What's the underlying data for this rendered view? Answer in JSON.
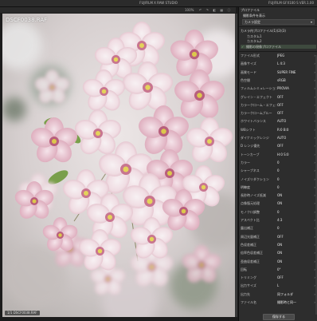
{
  "window": {
    "title": "FUJIFILM X RAW STUDIO",
    "right_title": "FUJIFILM GFX100 S   VER.1.00"
  },
  "toolbar": {
    "zoom": "100%",
    "icons": [
      "undo-icon",
      "redo-icon",
      "compare-icon",
      "grid-icon",
      "info-icon"
    ]
  },
  "viewer": {
    "filename": "DSCF0038.RAF",
    "footer": "1/1 DSCF0038.RAF"
  },
  "panel": {
    "header": "プロファイル",
    "profile_section_label": "撮影条件を表示",
    "profile_dropdown": "カメラ設定",
    "sub_header": "カメラ内プロファイル(1)(2)(3)",
    "items": [
      {
        "label": "カスタム1",
        "state": "checked"
      },
      {
        "label": "カスタム2",
        "state": ""
      },
      {
        "label": "撮影の現像プロファイル",
        "state": "selected"
      }
    ],
    "settings": [
      {
        "label": "ファイル形式",
        "value": "JPEG"
      },
      {
        "label": "画像サイズ",
        "value": "L 4:3"
      },
      {
        "label": "画質モード",
        "value": "SUPER FINE"
      },
      {
        "label": "色空間",
        "value": "sRGB"
      },
      {
        "label": "フィルムシミュレーション",
        "value": "PROVIA"
      },
      {
        "label": "グレイン・エフェクト",
        "value": "OFF"
      },
      {
        "label": "カラークローム・エフェクト",
        "value": "OFF"
      },
      {
        "label": "カラークロームブルー",
        "value": "OFF"
      },
      {
        "label": "ホワイトバランス",
        "value": "AUTO"
      },
      {
        "label": "WBシフト",
        "value": "R:0 B:0"
      },
      {
        "label": "ダイナミックレンジ",
        "value": "AUTO"
      },
      {
        "label": "D レンジ優先",
        "value": "OFF"
      },
      {
        "label": "トーンカーブ",
        "value": "H:0 S:0"
      },
      {
        "label": "カラー",
        "value": "0"
      },
      {
        "label": "シャープネス",
        "value": "0"
      },
      {
        "label": "ノイズリダクション",
        "value": "0"
      },
      {
        "label": "明瞭度",
        "value": "0"
      },
      {
        "label": "長秒時ノイズ低減",
        "value": "ON"
      },
      {
        "label": "点像復元処理",
        "value": "ON"
      },
      {
        "label": "モノクロ調整",
        "value": "0"
      },
      {
        "label": "アスペクト比",
        "value": "4:3"
      },
      {
        "label": "露出補正",
        "value": "0"
      },
      {
        "label": "周辺光量補正",
        "value": "OFF"
      },
      {
        "label": "色収差補正",
        "value": "ON"
      },
      {
        "label": "倍率色収差補正",
        "value": "ON"
      },
      {
        "label": "歪曲収差補正",
        "value": "ON"
      },
      {
        "label": "回転",
        "value": "0°"
      },
      {
        "label": "トリミング",
        "value": "OFF"
      },
      {
        "label": "出力サイズ",
        "value": "L"
      },
      {
        "label": "出力先",
        "value": "同フォルダ"
      },
      {
        "label": "ファイル名",
        "value": "撮影時と同一"
      }
    ],
    "save_button": "保存する"
  },
  "colors": {
    "bg": "#1c1c1c",
    "panel": "#2d2d2d",
    "accent": "#6a9a6a"
  }
}
